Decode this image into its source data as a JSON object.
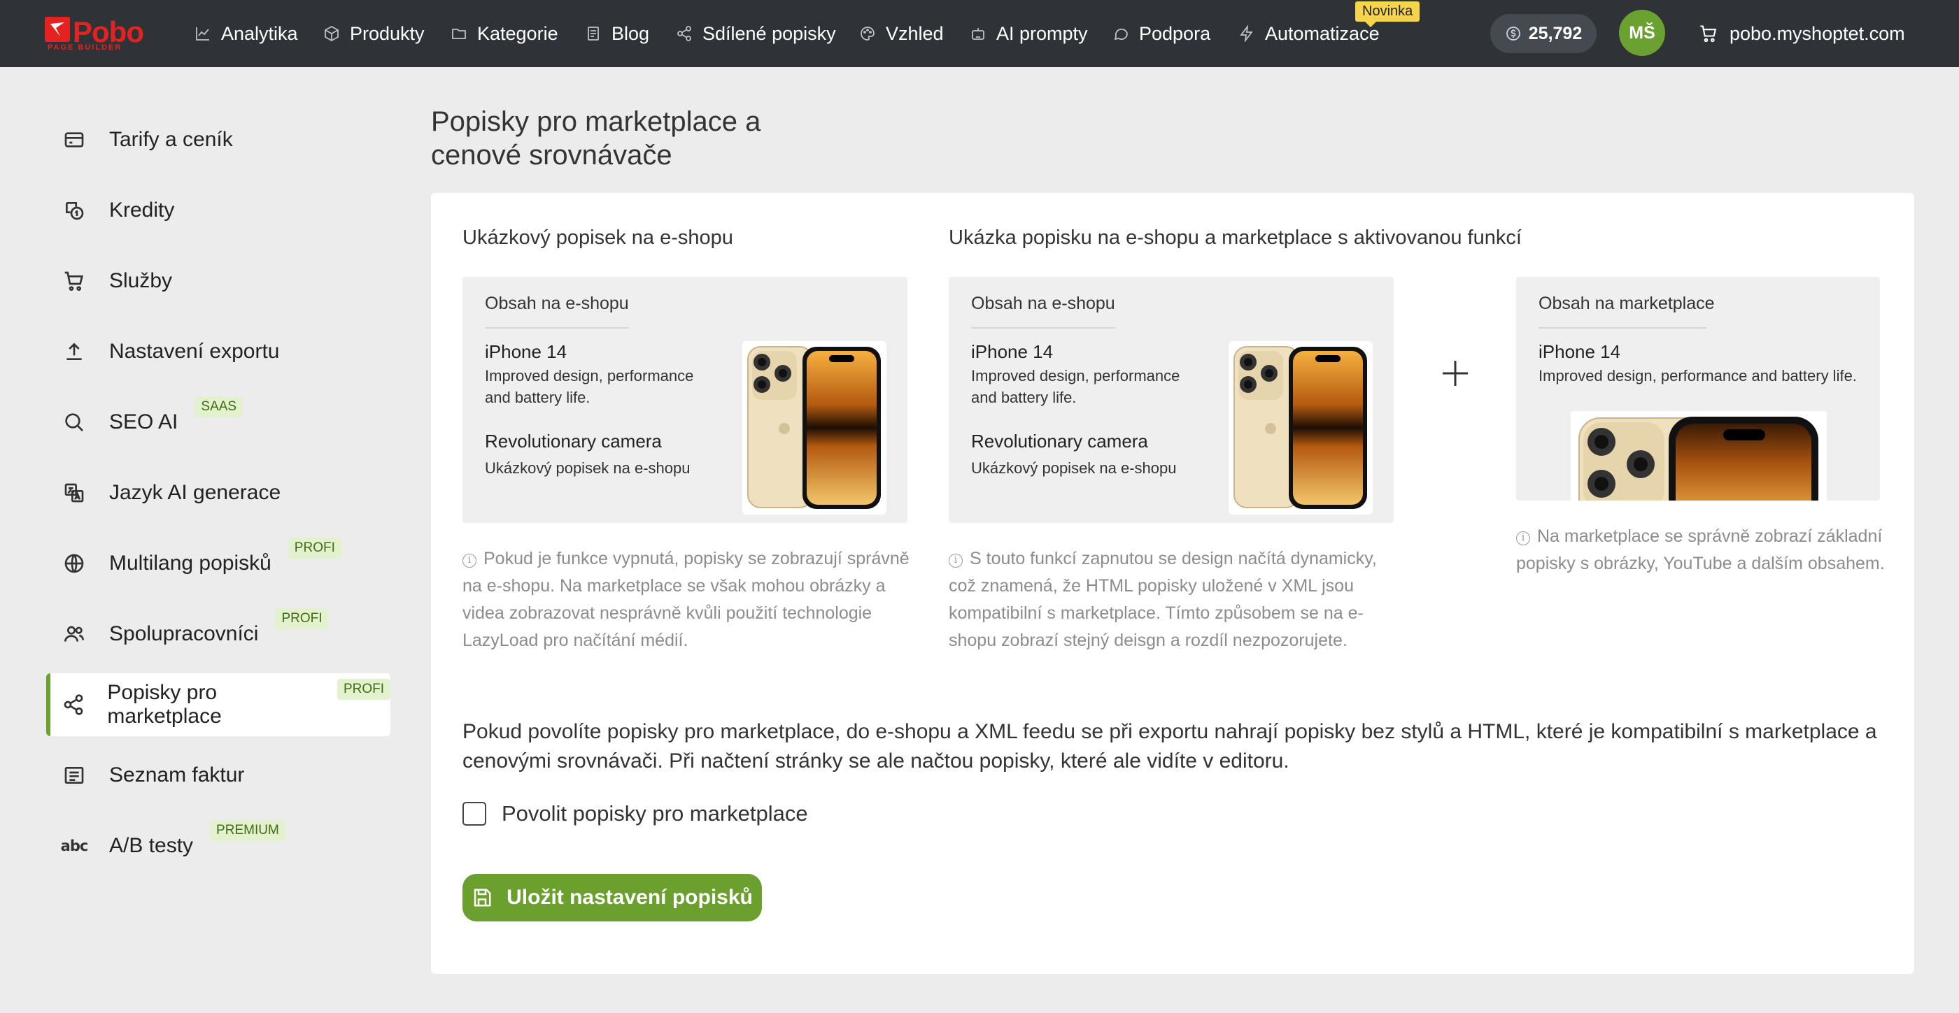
{
  "brand": {
    "name": "Pobo",
    "sub": "PAGE BUILDER"
  },
  "nav": [
    {
      "label": "Analytika",
      "icon": "chart-line-icon"
    },
    {
      "label": "Produkty",
      "icon": "box-icon"
    },
    {
      "label": "Kategorie",
      "icon": "folder-icon"
    },
    {
      "label": "Blog",
      "icon": "document-icon"
    },
    {
      "label": "Sdílené popisky",
      "icon": "share-icon"
    },
    {
      "label": "Vzhled",
      "icon": "palette-icon"
    },
    {
      "label": "AI prompty",
      "icon": "robot-icon"
    },
    {
      "label": "Podpora",
      "icon": "chat-icon"
    },
    {
      "label": "Automatizace",
      "icon": "bolt-icon"
    }
  ],
  "nav_badge": "Novinka",
  "credits": "25,792",
  "avatar": "MŠ",
  "shop": "pobo.myshoptet.com",
  "sidebar": [
    {
      "label": "Tarify a ceník",
      "icon": "credit-card-icon",
      "badge": ""
    },
    {
      "label": "Kredity",
      "icon": "coins-icon",
      "badge": ""
    },
    {
      "label": "Služby",
      "icon": "cart-icon",
      "badge": ""
    },
    {
      "label": "Nastavení exportu",
      "icon": "upload-icon",
      "badge": ""
    },
    {
      "label": "SEO AI",
      "icon": "search-icon",
      "badge": "SAAS"
    },
    {
      "label": "Jazyk AI generace",
      "icon": "translate-icon",
      "badge": ""
    },
    {
      "label": "Multilang popisků",
      "icon": "globe-icon",
      "badge": "PROFI"
    },
    {
      "label": "Spolupracovníci",
      "icon": "users-icon",
      "badge": "PROFI"
    },
    {
      "label": "Popisky pro marketplace",
      "icon": "share-icon",
      "badge": "PROFI"
    },
    {
      "label": "Seznam faktur",
      "icon": "list-icon",
      "badge": ""
    },
    {
      "label": "A/B testy",
      "icon": "abc-icon",
      "badge": "PREMIUM"
    }
  ],
  "main": {
    "title": "Popisky pro marketplace a cenové srovnávače",
    "left_section_title": "Ukázkový popisek na e-shopu",
    "right_section_title": "Ukázka popisku na e-shopu a marketplace s aktivovanou funkcí",
    "eshop_head": "Obsah na e-shopu",
    "marketplace_head": "Obsah na marketplace",
    "product": "iPhone 14",
    "product_text": "Improved design, performance and battery life.",
    "feature": "Revolutionary camera",
    "feature_text": "Ukázkový popisek na e-shopu",
    "note_off": "Pokud je funkce vypnutá, popisky se zobrazují správně na e-shopu. Na marketplace se však mohou obrázky a videa zobrazovat nesprávně kvůli použití technologie LazyLoad pro načítání médií.",
    "note_on": "S touto funkcí zapnutou se design načítá dynamicky, což znamená, že HTML popisky uložené v XML jsou kompatibilní s marketplace. Tímto způsobem se na e-shopu zobrazí stejný deisgn a rozdíl nezpozorujete.",
    "note_marketplace": "Na marketplace se správně zobrazí základní popisky s obrázky, YouTube a dalším obsahem.",
    "description": "Pokud povolíte popisky pro marketplace, do e-shopu a XML feedu se při exportu nahrají popisky bez stylů a HTML, které je kompatibilní s marketplace a cenovými srovnávači. Při načtení stránky se ale načtou popisky, které ale vidíte v editoru.",
    "checkbox_label": "Povolit popisky pro marketplace",
    "checkbox_checked": false,
    "save_label": "Uložit nastavení popisků"
  },
  "colors": {
    "accent": "#6aa130",
    "topbar": "#2f3338",
    "brand": "#e42320",
    "badge_bg": "#e4f1cf"
  }
}
